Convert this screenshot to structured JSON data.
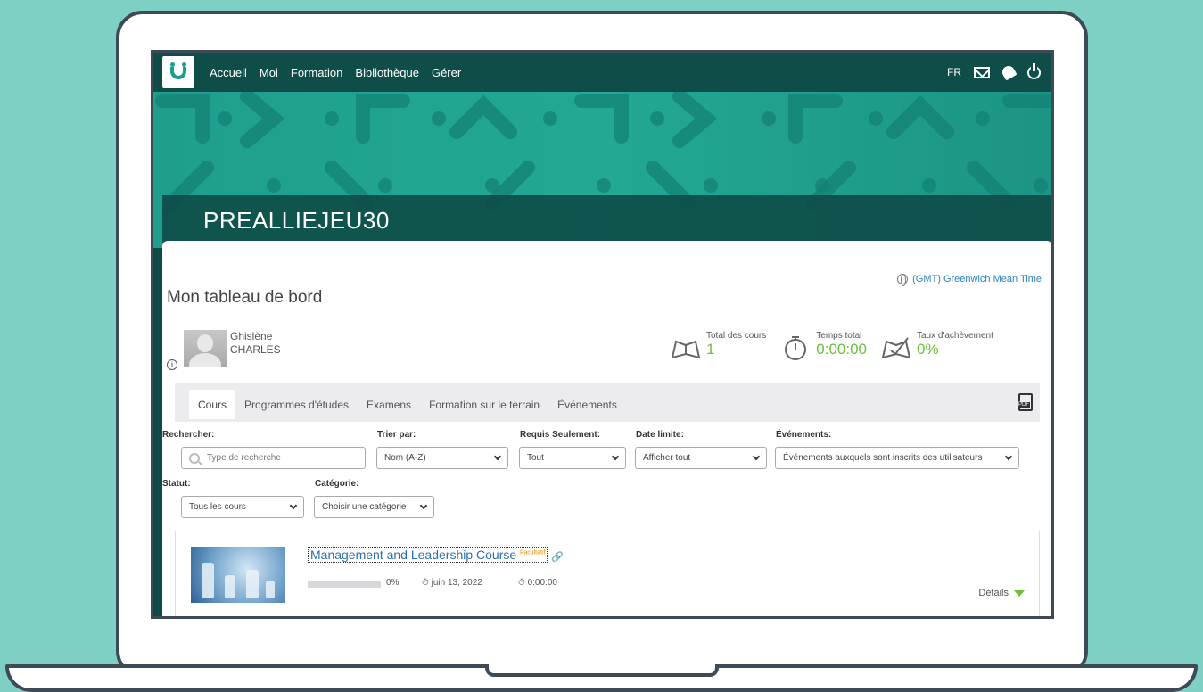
{
  "nav": {
    "items": [
      "Accueil",
      "Moi",
      "Formation",
      "Bibliothèque",
      "Gérer"
    ],
    "lang": "FR"
  },
  "banner": {
    "title": "PREALLIEJEU30"
  },
  "dashboard": {
    "title": "Mon tableau de bord",
    "timezone": "(GMT) Greenwich Mean Time",
    "user": {
      "first": "Ghislène",
      "last": "CHARLES"
    },
    "stats": {
      "courses": {
        "label": "Total des cours",
        "value": "1"
      },
      "time": {
        "label": "Temps total",
        "value": "0:00:00"
      },
      "completion": {
        "label": "Taux d'achèvement",
        "value": "0%"
      }
    }
  },
  "tabs": [
    "Cours",
    "Programmes d'études",
    "Examens",
    "Formation sur le terrain",
    "Événements"
  ],
  "filters": {
    "search": {
      "label": "Rechercher:",
      "placeholder": "Type de recherche"
    },
    "sort": {
      "label": "Trier par:",
      "value": "Nom (A-Z)"
    },
    "required": {
      "label": "Requis Seulement:",
      "value": "Tout"
    },
    "deadline": {
      "label": "Date limite:",
      "value": "Afficher tout"
    },
    "events": {
      "label": "Événements:",
      "value": "Événements auxquels sont inscrits des utilisateurs"
    },
    "status": {
      "label": "Statut:",
      "value": "Tous les cours"
    },
    "category": {
      "label": "Catégorie:",
      "value": "Choisir une catégorie"
    }
  },
  "course": {
    "title": "Management and Leadership Course",
    "badge": "Facultatif",
    "progress": "0%",
    "progress_fraction": 0,
    "date": "juin 13, 2022",
    "duration": "0:00:00",
    "details_label": "Détails"
  },
  "colors": {
    "primary": "#0f4d49",
    "accent_green": "#6cbf3a",
    "link_blue": "#2b6fb0",
    "badge_orange": "#f08c00"
  }
}
